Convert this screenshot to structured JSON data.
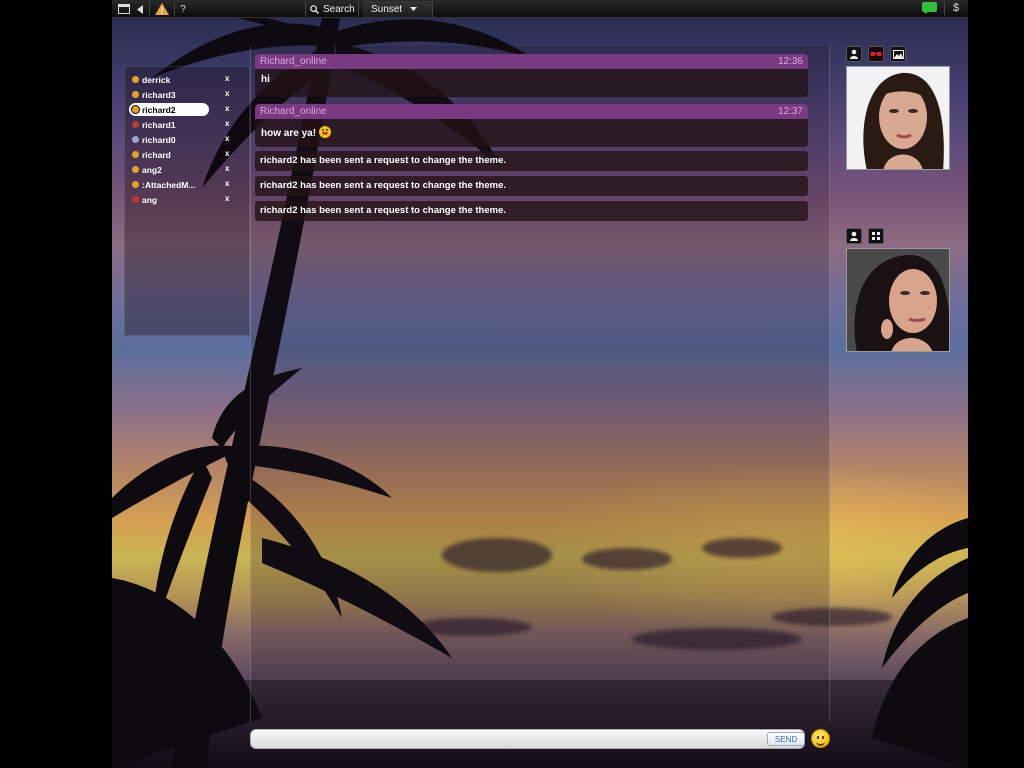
{
  "toolbar": {
    "help_label": "?",
    "search_label": "Search",
    "theme_label": "Sunset"
  },
  "contacts": [
    {
      "name": "derrick",
      "status_color": "#e8a321",
      "selected": false
    },
    {
      "name": "richard3",
      "status_color": "#e8a321",
      "selected": false
    },
    {
      "name": "richard2",
      "status_color": "#e8a321",
      "selected": true
    },
    {
      "name": "richard1",
      "status_color": "#c0392b",
      "selected": false
    },
    {
      "name": "richard0",
      "status_color": "#9aa4c8",
      "selected": false
    },
    {
      "name": "richard",
      "status_color": "#e8a321",
      "selected": false
    },
    {
      "name": "ang2",
      "status_color": "#e8a321",
      "selected": false
    },
    {
      "name": ":AttachedM...",
      "status_color": "#e8a321",
      "selected": false
    },
    {
      "name": "ang",
      "status_color": "#c0392b",
      "selected": false
    }
  ],
  "remove_label": "x",
  "messages": [
    {
      "sender": "Richard_online",
      "time": "12:36",
      "text": "hi"
    },
    {
      "sender": "Richard_online",
      "time": "12:37",
      "text": "how are ya!"
    }
  ],
  "system_messages": [
    "richard2 has been sent a request to change the theme.",
    "richard2 has been sent a request to change the theme.",
    "richard2 has been sent a request to change the theme."
  ],
  "input": {
    "value": "",
    "send_label": "SEND"
  },
  "icons": {
    "window": "window-icon",
    "back": "back-icon",
    "warning": "warning-icon",
    "search": "search-icon",
    "dropdown": "chevron-down-icon",
    "status": "status-green-icon",
    "dollar": "dollar-icon"
  },
  "colors": {
    "header_purple": "#7a3a82",
    "sender_text": "#d6a9dc",
    "status_green": "#35c03a"
  }
}
